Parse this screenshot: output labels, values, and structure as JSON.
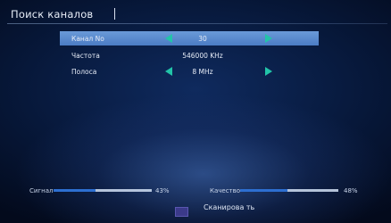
{
  "title": "Поиск каналов",
  "rows": [
    {
      "label": "Канал No",
      "value": "30",
      "arrows": true,
      "selected": true
    },
    {
      "label": "Частота",
      "value": "546000  KHz",
      "arrows": false,
      "selected": false
    },
    {
      "label": "Полоса",
      "value": "8  MHz",
      "arrows": true,
      "selected": false
    }
  ],
  "signal": {
    "label": "Сигнал",
    "percent_text": "43%",
    "level": 0.43
  },
  "quality": {
    "label": "Качество",
    "percent_text": "48%",
    "level": 0.48
  },
  "scan": {
    "label": "Сканирова ть"
  },
  "colors": {
    "accent": "#22c4a8",
    "selection": "#5a8ad0",
    "bar_fill": "#2d6fd1"
  },
  "icons": {
    "left": "arrow-left-icon",
    "right": "arrow-right-icon",
    "scan": "scan-button-icon"
  }
}
